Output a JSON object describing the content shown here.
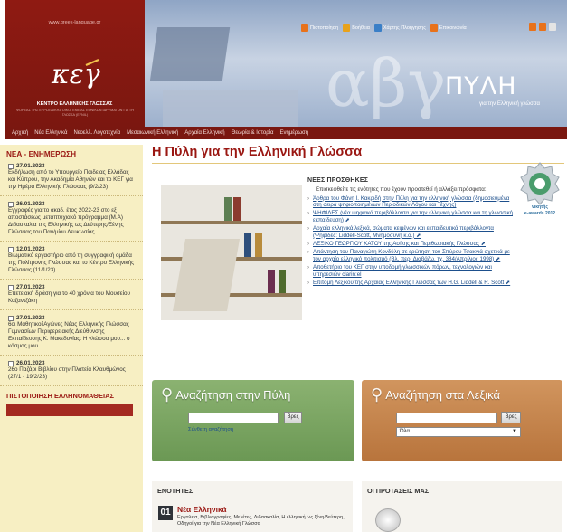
{
  "brand": {
    "url": "www.greek-language.gr",
    "center_name": "ΚΕΝΤΡΟ ΕΛΛΗΝΙΚΗΣ ΓΛΩΣΣΑΣ",
    "center_sub": "ΦΟΡΕΑΣ ΤΗΣ ΕΥΡΩΠΑΪΚΗΣ ΟΙΚΟΓΕΝΕΙΑΣ ΕΘΝΙΚΩΝ ΙΔΡΥΜΑΤΩΝ ΓΙΑ ΤΗ ΓΛΩΣΣΑ (EFNIL)"
  },
  "header": {
    "title": "ΠΥΛΗ",
    "subtitle": "για την Ελληνική γλώσσα",
    "banner_text": "αβγ",
    "links": [
      "Πιστοποίηση",
      "Βοήθεια",
      "Χάρτης Πλοήγησης",
      "Επικοινωνία"
    ],
    "link_colors": [
      "#e8721b",
      "#e8a21b",
      "#3a7fc7",
      "#e8721b"
    ],
    "lang_icons": [
      "flag-icon",
      "flag-icon",
      "flag-icon"
    ]
  },
  "nav": {
    "items": [
      "Αρχική",
      "Νέα Ελληνικά",
      "Νεοελλ. Λογοτεχνία",
      "Μεσαιωνική Ελληνική",
      "Αρχαία Ελληνική",
      "Θεωρία & Ιστορία",
      "Ενημέρωση"
    ]
  },
  "sidebar": {
    "heading": "ΝΕΑ - ΕΝΗΜΕΡΩΣΗ",
    "news": [
      {
        "date": "27.01.2023",
        "text": "Εκδήλωση από το Υπουργείο Παιδείας Ελλάδας και Κύπρου, την Ακαδημία Αθηνών και το ΚΕΓ για την Ημέρα Ελληνικής Γλώσσας (9/2/23)"
      },
      {
        "date": "26.01.2023",
        "text": "Εγγραφές για το ακαδ. έτος 2022-23 στο εξ αποστάσεως μεταπτυχιακό πρόγραμμα (Μ.Α) Διδασκαλία της Ελληνικής ως Δεύτερης/Ξένης Γλώσσας του Παν/μίου Λευκωσίας"
      },
      {
        "date": "12.01.2023",
        "text": "Βιωματικό εργαστήριο από τη συγγραφική ομάδα της Πολίτρονης Γλώσσας και το Κέντρο Ελληνικής Γλώσσας (11/1/23)"
      },
      {
        "date": "27.01.2023",
        "text": "Επετειακή δράση για το 40 χρόνια του Μουσείου Καζαντζάκη"
      },
      {
        "date": "27.01.2023",
        "text": "6οι Μαθητικοί Αγώνες Νέας Ελληνικής Γλώσσας Γυμνασίων Περιφερειακής Διεύθυνσης Εκπαίδευσης Κ. Μακεδονίας: Η γλώσσα μου... ο κόσμος μου"
      },
      {
        "date": "26.01.2023",
        "text": "26ο Παζάρι Βιβλίου στην Πλατεία Κλαυθμώνος (27/1 - 19/2/23)"
      }
    ],
    "pist_heading": "ΠΙΣΤΟΠΟΙΗΣΗ ΕΛΛΗΝΟΜΑΘΕΙΑΣ"
  },
  "main": {
    "title": "Η Πύλη για την Ελληνική Γλώσσα",
    "news_heading": "ΝΕΕΣ ΠΡΟΣΘΗΚΕΣ",
    "news_intro": "Επισκεφθείτε τις ενότητες που έχουν προστεθεί ή αλλάξει πρόσφατα:",
    "news_items": [
      "Άρθρα του Φάνη Ι. Κακριδή στην Πύλη για την ελληνική γλώσσα (δημοσιευμένα στη σειρά ψηφιοποιημένων Περιοδικών Λόγου και Τέχνης)",
      "ΨΗΦΙΔΕΣ (νέα ψηφιακά περιβάλλοντα για την ελληνική γλώσσα και τη γλωσσική εκπαίδευση) ⬈",
      "Αρχαία ελληνικά λεξικά, σώματα κειμένων και εκπαιδευτικά περιβάλλοντα (Ψηφίδες: Liddell-Scott, Μνημοσύνη κ.ά.) ⬈",
      "ΛΕΞΙΚΟ ΓΕΩΡΓΙΟΥ ΚΑΤΟΥ της Ασίκης και Περιθωριακής Γλώσσας ⬈",
      "Απάντηση του Παναγιώτη Κονδύλη σε ερώτηση του Σπύρου Τσακνιά σχετικά με τον αρχαίο ελληνικό πολιτισμό (Βλ. περ. Διαβάζω, τχ. 384/Απρίλιος 1998) ⬈",
      "Αποθετήριο του ΚΕΓ στην υποδομή γλωσσικών πόρων, τεχνολογιών και υπηρεσιών clarin:el",
      "Επιτομή Λεξικού της Αρχαίας Ελληνικής Γλώσσας των H.G. Liddell & R. Scott ⬈"
    ],
    "medal": {
      "line1": "νικητής",
      "line2": "e-awards 2012"
    }
  },
  "search_portal": {
    "title": "Αναζήτηση στην Πύλη",
    "button": "Βρες",
    "advanced": "Σύνθετη αναζήτηση"
  },
  "search_dict": {
    "title": "Αναζήτηση στα Λεξικά",
    "button": "Βρες",
    "select": "Όλα"
  },
  "sections": {
    "heading": "ΕΝΟΤΗΤΕΣ",
    "num": "01",
    "name": "Νέα Ελληνικά",
    "desc": "Εργαλεία, Βιβλιογραφίες, Μελέτες, Διδασκαλία, Η ελληνική ως ξένη/δεύτερη, Οδηγοί για την Νέα Ελληνική Γλώσσα"
  },
  "suggestions": {
    "heading": "ΟΙ ΠΡΟΤΑΣΕΙΣ ΜΑΣ"
  }
}
